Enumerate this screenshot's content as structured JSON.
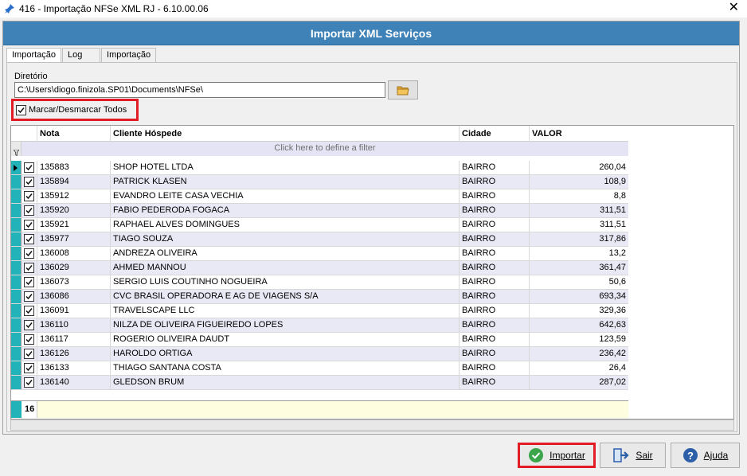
{
  "window": {
    "title": "416 - Importação NFSe XML RJ - 6.10.00.06",
    "close_glyph": "✕"
  },
  "header": {
    "title": "Importar XML Serviços"
  },
  "tabs": [
    {
      "label": "Importação"
    },
    {
      "label": "Log"
    },
    {
      "label": "Importação"
    }
  ],
  "directory": {
    "label": "Diretório",
    "value": "C:\\Users\\diogo.finizola.SP01\\Documents\\NFSe\\"
  },
  "select_all": {
    "label": "Marcar/Desmarcar Todos",
    "checked": true
  },
  "grid": {
    "columns": [
      "Nota",
      "Cliente Hóspede",
      "Cidade",
      "VALOR"
    ],
    "filter_text": "Click here to define a filter",
    "rows": [
      {
        "nota": "135883",
        "cliente": "SHOP HOTEL LTDA",
        "cidade": "BAIRRO",
        "valor": "260,04"
      },
      {
        "nota": "135894",
        "cliente": "PATRICK KLASEN",
        "cidade": "BAIRRO",
        "valor": "108,9"
      },
      {
        "nota": "135912",
        "cliente": "EVANDRO LEITE CASA VECHIA",
        "cidade": "BAIRRO",
        "valor": "8,8"
      },
      {
        "nota": "135920",
        "cliente": "FABIO PEDERODA FOGACA",
        "cidade": "BAIRRO",
        "valor": "311,51"
      },
      {
        "nota": "135921",
        "cliente": "RAPHAEL ALVES DOMINGUES",
        "cidade": "BAIRRO",
        "valor": "311,51"
      },
      {
        "nota": "135977",
        "cliente": "TIAGO SOUZA",
        "cidade": "BAIRRO",
        "valor": "317,86"
      },
      {
        "nota": "136008",
        "cliente": "ANDREZA OLIVEIRA",
        "cidade": "BAIRRO",
        "valor": "13,2"
      },
      {
        "nota": "136029",
        "cliente": "AHMED MANNOU",
        "cidade": "BAIRRO",
        "valor": "361,47"
      },
      {
        "nota": "136073",
        "cliente": "SERGIO LUIS COUTINHO NOGUEIRA",
        "cidade": "BAIRRO",
        "valor": "50,6"
      },
      {
        "nota": "136086",
        "cliente": "CVC BRASIL OPERADORA E AG DE VIAGENS S/A",
        "cidade": "BAIRRO",
        "valor": "693,34"
      },
      {
        "nota": "136091",
        "cliente": "TRAVELSCAPE LLC",
        "cidade": "BAIRRO",
        "valor": "329,36"
      },
      {
        "nota": "136110",
        "cliente": "NILZA DE OLIVEIRA FIGUEIREDO LOPES",
        "cidade": "BAIRRO",
        "valor": "642,63"
      },
      {
        "nota": "136117",
        "cliente": "ROGERIO OLIVEIRA DAUDT",
        "cidade": "BAIRRO",
        "valor": "123,59"
      },
      {
        "nota": "136126",
        "cliente": "HAROLDO ORTIGA",
        "cidade": "BAIRRO",
        "valor": "236,42"
      },
      {
        "nota": "136133",
        "cliente": "THIAGO SANTANA COSTA",
        "cidade": "BAIRRO",
        "valor": "26,4"
      },
      {
        "nota": "136140",
        "cliente": "GLEDSON BRUM",
        "cidade": "BAIRRO",
        "valor": "287,02"
      }
    ],
    "footer_count": "16"
  },
  "buttons": {
    "import_label": "Importar",
    "exit_label": "Sair",
    "help_label": "Ajuda"
  },
  "colors": {
    "header_band": "#3f82b8",
    "row_indicator": "#21b3b8",
    "highlight_box": "#e21b25",
    "import_icon": "#3aa54a",
    "help_icon": "#2d5fa8"
  }
}
